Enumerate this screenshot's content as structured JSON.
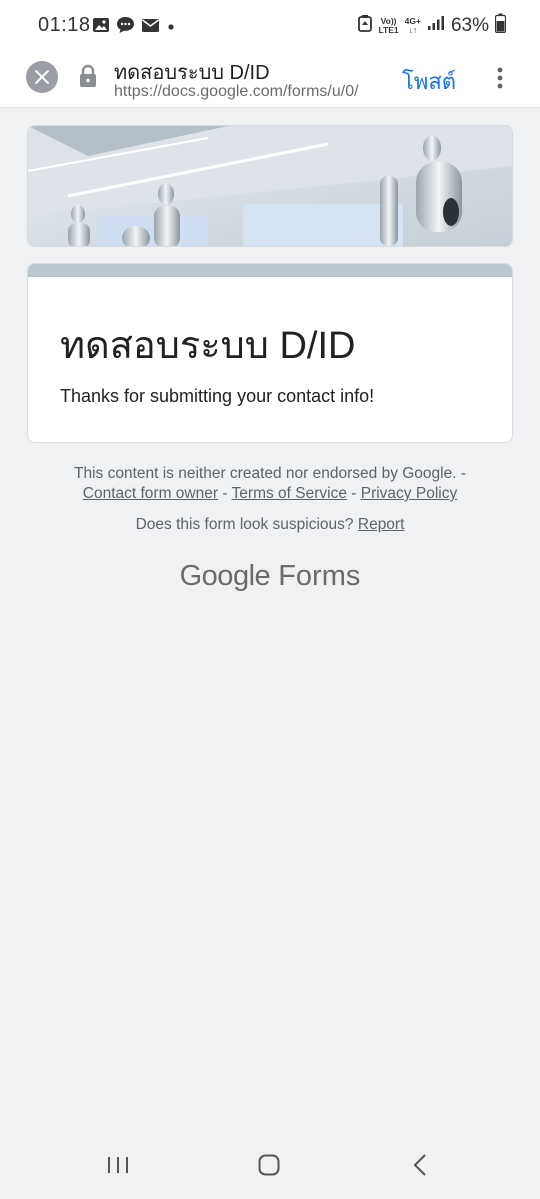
{
  "status_bar": {
    "time": "01:18",
    "network_top": "Vo))",
    "network_bottom": "LTE1",
    "net_type_top": "4G+",
    "battery": "63%"
  },
  "toolbar": {
    "title": "ทดสอบระบบ D/ID",
    "url": "https://docs.google.com/forms/u/0/",
    "post_label": "โพสต์"
  },
  "form": {
    "title": "ทดสอบระบบ D/ID",
    "message": "Thanks for submitting your contact info!"
  },
  "footer": {
    "disclaimer": "This content is neither created nor endorsed by Google.",
    "sep": " - ",
    "contact_owner": "Contact form owner",
    "terms": "Terms of Service",
    "privacy": "Privacy Policy",
    "suspicious_q": "Does this form look suspicious?",
    "report": "Report",
    "brand_google": "Google",
    "brand_forms": "Forms"
  },
  "colors": {
    "accent": "#1a73e8",
    "card_header": "#b9c7cf",
    "background": "#f0f1f3"
  }
}
